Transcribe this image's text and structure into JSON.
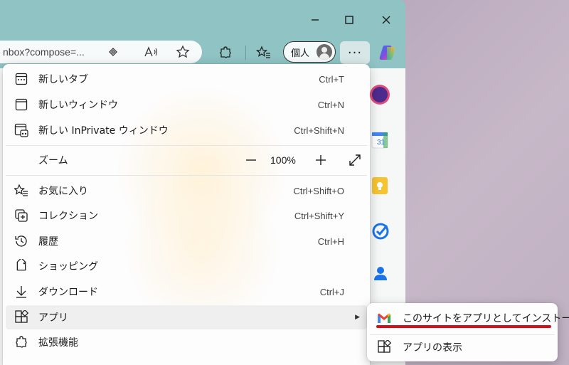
{
  "window": {
    "minimize_icon": "minimize-icon",
    "maximize_icon": "maximize-icon",
    "close_icon": "close-icon"
  },
  "address_bar": {
    "url": "nbox?compose=..."
  },
  "toolbar": {
    "profile_label": "個人",
    "more_label": "···"
  },
  "menu": {
    "items": [
      {
        "label": "新しいタブ",
        "shortcut": "Ctrl+T",
        "icon": "new-tab-icon"
      },
      {
        "label": "新しいウィンドウ",
        "shortcut": "Ctrl+N",
        "icon": "new-window-icon"
      },
      {
        "label": "新しい InPrivate ウィンドウ",
        "shortcut": "Ctrl+Shift+N",
        "icon": "inprivate-icon"
      },
      {
        "label": "ズーム",
        "zoom_minus": "—",
        "zoom_value": "100%",
        "zoom_plus": "+",
        "icon": "fullscreen-icon"
      },
      {
        "label": "お気に入り",
        "shortcut": "Ctrl+Shift+O",
        "icon": "favorites-icon"
      },
      {
        "label": "コレクション",
        "shortcut": "Ctrl+Shift+Y",
        "icon": "collections-icon"
      },
      {
        "label": "履歴",
        "shortcut": "Ctrl+H",
        "icon": "history-icon"
      },
      {
        "label": "ショッピング",
        "shortcut": "",
        "icon": "shopping-tag-icon"
      },
      {
        "label": "ダウンロード",
        "shortcut": "Ctrl+J",
        "icon": "download-icon"
      },
      {
        "label": "アプリ",
        "shortcut": "",
        "icon": "apps-icon",
        "arrow": "▶"
      },
      {
        "label": "拡張機能",
        "shortcut": "",
        "icon": "extensions-icon"
      }
    ]
  },
  "submenu": {
    "items": [
      {
        "label": "このサイトをアプリとしてインストール",
        "icon": "gmail-icon"
      },
      {
        "label": "アプリの表示",
        "icon": "apps-icon"
      }
    ],
    "highlight_color": "#d0101a"
  }
}
